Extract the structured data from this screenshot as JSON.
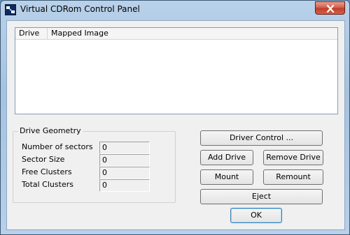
{
  "window": {
    "title": "Virtual CDRom Control Panel"
  },
  "listview": {
    "columns": [
      "Drive",
      "Mapped Image"
    ]
  },
  "drive_geometry": {
    "title": "Drive Geometry",
    "fields": [
      {
        "label": "Number of sectors",
        "value": "0"
      },
      {
        "label": "Sector Size",
        "value": "0"
      },
      {
        "label": "Free Clusters",
        "value": "0"
      },
      {
        "label": "Total Clusters",
        "value": "0"
      }
    ]
  },
  "buttons": {
    "driver_control": "Driver Control ...",
    "add_drive": "Add Drive",
    "remove_drive": "Remove Drive",
    "mount": "Mount",
    "remount": "Remount",
    "eject": "Eject",
    "ok": "OK"
  },
  "icons": {
    "app": "cdrom-app-icon",
    "close": "close-icon"
  },
  "colors": {
    "close_button": "#c13b26",
    "titlebar": "#b9d1ea"
  }
}
